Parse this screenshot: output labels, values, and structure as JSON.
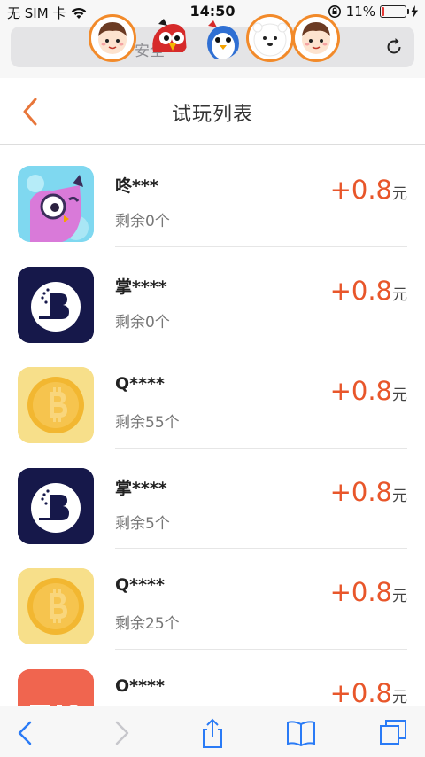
{
  "status_bar": {
    "carrier": "无 SIM 卡",
    "time": "14:50",
    "battery": "11%",
    "battery_level": 0.11
  },
  "browser": {
    "address_text": "安全"
  },
  "header": {
    "title": "试玩列表"
  },
  "items": [
    {
      "name": "咚***",
      "remaining": "剩余0个",
      "reward": "+0.8",
      "unit": "元",
      "icon": "owl-app-icon"
    },
    {
      "name": "掌****",
      "remaining": "剩余0个",
      "reward": "+0.8",
      "unit": "元",
      "icon": "b-logo-app-icon"
    },
    {
      "name": "Q****",
      "remaining": "剩余55个",
      "reward": "+0.8",
      "unit": "元",
      "icon": "bitcoin-app-icon"
    },
    {
      "name": "掌****",
      "remaining": "剩余5个",
      "reward": "+0.8",
      "unit": "元",
      "icon": "b-logo-app-icon"
    },
    {
      "name": "Q****",
      "remaining": "剩余25个",
      "reward": "+0.8",
      "unit": "元",
      "icon": "bitcoin-app-icon"
    },
    {
      "name": "O****",
      "remaining": "",
      "reward": "+0.8",
      "unit": "元",
      "icon": "red-app-icon"
    }
  ],
  "colors": {
    "accent": "#e8562a",
    "avatar_border": "#f28a2a",
    "b_logo_bg": "#16184a"
  }
}
